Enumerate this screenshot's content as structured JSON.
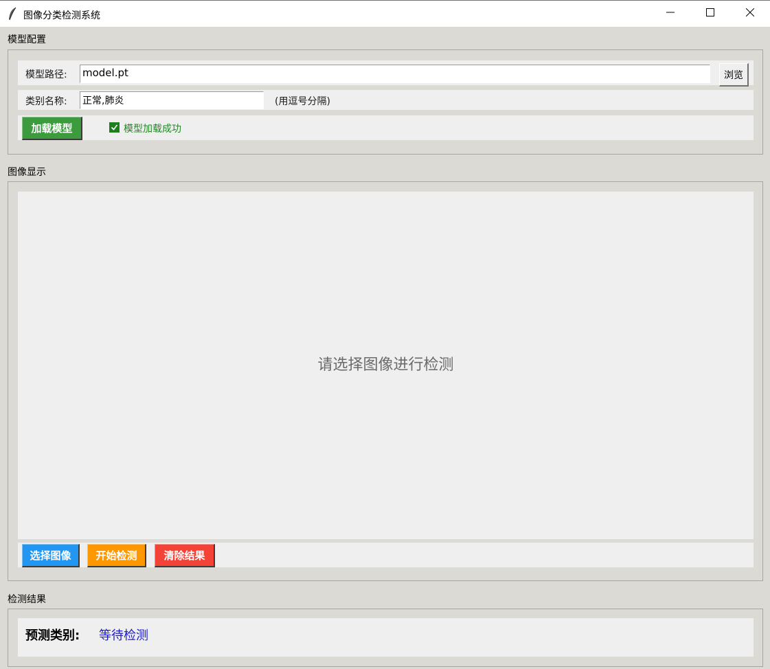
{
  "window": {
    "title": "图像分类检测系统",
    "app_icon": "feather-icon",
    "controls": [
      "minimize-icon",
      "maximize-icon",
      "close-icon"
    ]
  },
  "model_config": {
    "group_title": "模型配置",
    "model_path_label": "模型路径:",
    "model_path_value": "model.pt",
    "browse_label": "浏览",
    "class_names_label": "类别名称:",
    "class_names_value": "正常,肺炎",
    "class_names_hint": "(用逗号分隔)",
    "load_button": "加载模型",
    "load_status": "模型加载成功",
    "load_status_color": "#1f8a1f"
  },
  "image_display": {
    "group_title": "图像显示",
    "placeholder": "请选择图像进行检测",
    "buttons": {
      "select": "选择图像",
      "detect": "开始检测",
      "clear": "清除结果"
    }
  },
  "results": {
    "group_title": "检测结果",
    "prediction_label": "预测类别:",
    "prediction_value": "等待检测",
    "prediction_color": "#1a1ad6"
  },
  "colors": {
    "load_green": "#3c9b3c",
    "select_blue": "#2196f3",
    "detect_orange": "#ff9800",
    "clear_red": "#f44336"
  }
}
